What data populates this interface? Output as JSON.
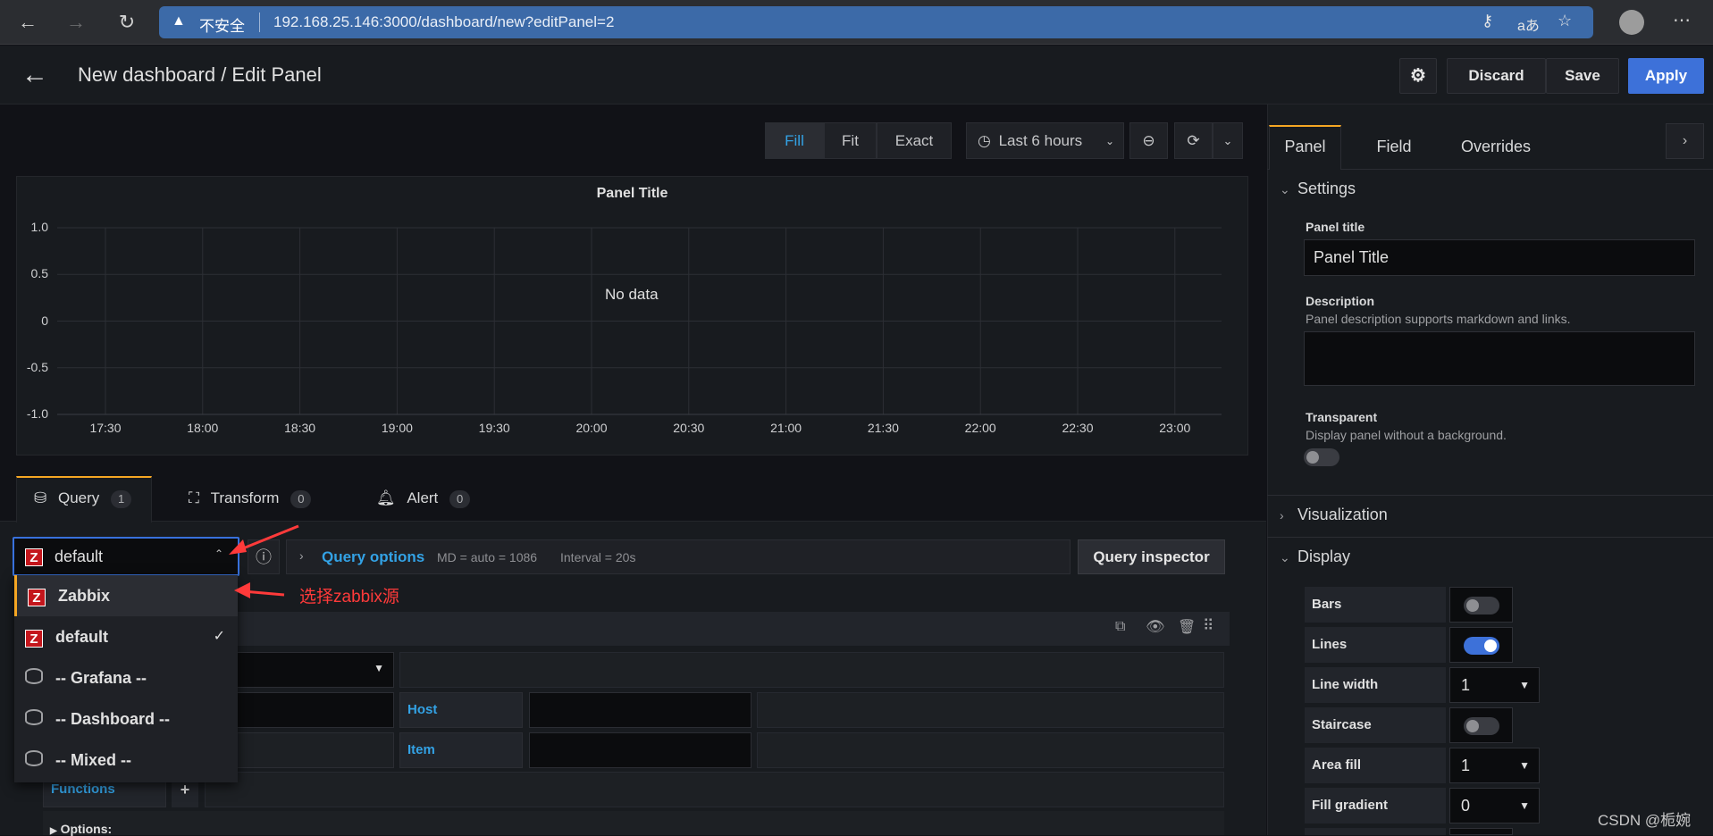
{
  "browser": {
    "warning_label": "不安全",
    "url": "192.168.25.146:3000/dashboard/new?editPanel=2"
  },
  "header": {
    "title": "New dashboard / Edit Panel",
    "discard_label": "Discard",
    "save_label": "Save",
    "apply_label": "Apply"
  },
  "view_toolbar": {
    "fill_label": "Fill",
    "fit_label": "Fit",
    "exact_label": "Exact",
    "time_range": "Last 6 hours"
  },
  "panel": {
    "title": "Panel Title",
    "no_data": "No data",
    "y_ticks": [
      "1.0",
      "0.5",
      "0",
      "-0.5",
      "-1.0"
    ],
    "x_ticks": [
      "17:30",
      "18:00",
      "18:30",
      "19:00",
      "19:30",
      "20:00",
      "20:30",
      "21:00",
      "21:30",
      "22:00",
      "22:30",
      "23:00"
    ]
  },
  "query_tabs": [
    {
      "label": "Query",
      "count": "1"
    },
    {
      "label": "Transform",
      "count": "0"
    },
    {
      "label": "Alert",
      "count": "0"
    }
  ],
  "query_editor": {
    "datasource_value": "default",
    "query_options_label": "Query options",
    "md_info": "MD = auto = 1086",
    "interval_info": "Interval = 20s",
    "inspector_label": "Query inspector",
    "host_label": "Host",
    "item_label": "Item",
    "functions_label": "Functions",
    "options_label": "Options:"
  },
  "datasource_dropdown": [
    {
      "label": "Zabbix",
      "icon": "zabbix-logo"
    },
    {
      "label": "default",
      "icon": "zabbix-logo",
      "selected": true
    },
    {
      "label": "-- Grafana --",
      "icon": "database-icon"
    },
    {
      "label": "-- Dashboard --",
      "icon": "database-icon"
    },
    {
      "label": "-- Mixed --",
      "icon": "database-icon"
    }
  ],
  "annotation": "选择zabbix源",
  "sidebar": {
    "tabs": [
      "Panel",
      "Field",
      "Overrides"
    ],
    "settings_label": "Settings",
    "panel_title_label": "Panel title",
    "panel_title_value": "Panel Title",
    "description_label": "Description",
    "description_help": "Panel description supports markdown and links.",
    "transparent_label": "Transparent",
    "transparent_help": "Display panel without a background.",
    "visualization_label": "Visualization",
    "display_label": "Display",
    "display_rows": [
      {
        "label": "Bars",
        "type": "toggle",
        "on": false
      },
      {
        "label": "Lines",
        "type": "toggle",
        "on": true
      },
      {
        "label": "Line width",
        "type": "select",
        "value": "1"
      },
      {
        "label": "Staircase",
        "type": "toggle",
        "on": false
      },
      {
        "label": "Area fill",
        "type": "select",
        "value": "1"
      },
      {
        "label": "Fill gradient",
        "type": "select",
        "value": "0"
      }
    ]
  },
  "watermark": "CSDN @栀婉",
  "colors": {
    "accent": "#3d71d9",
    "tab_active": "#f5a623",
    "link": "#33a2e5"
  }
}
